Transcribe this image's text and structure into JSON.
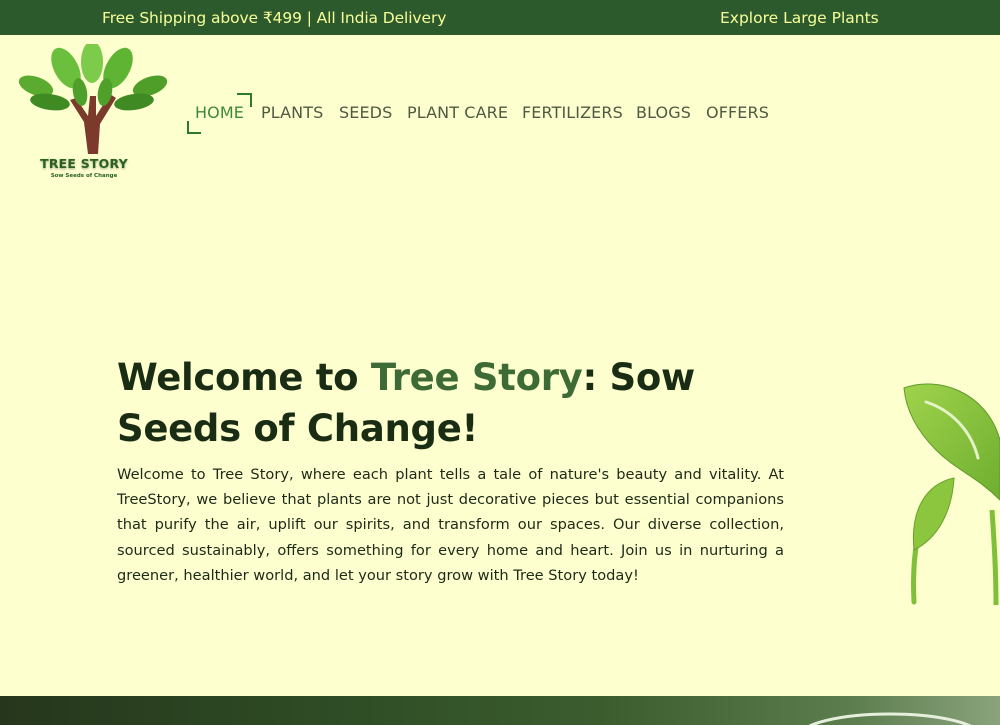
{
  "topbar": {
    "shipping_text": "Free Shipping above ₹499 | All India Delivery",
    "explore_link": "Explore Large Plants"
  },
  "logo": {
    "title": "TREE STORY",
    "tagline": "Sow Seeds of Change"
  },
  "nav": {
    "items": [
      {
        "label": "HOME",
        "active": true
      },
      {
        "label": "PLANTS",
        "active": false
      },
      {
        "label": "SEEDS",
        "active": false
      },
      {
        "label": "PLANT CARE",
        "active": false
      },
      {
        "label": "FERTILIZERS",
        "active": false
      },
      {
        "label": "BLOGS",
        "active": false
      },
      {
        "label": "OFFERS",
        "active": false
      }
    ]
  },
  "hero": {
    "title_part1": "Welcome to ",
    "title_accent": "Tree Story",
    "title_part2": ": Sow Seeds of Change!",
    "paragraph": "Welcome to Tree Story, where each plant tells a tale of nature's beauty and vitality. At TreeStory, we believe that plants are not just decorative pieces but essential companions that purify the air, uplift our spirits, and transform our spaces. Our diverse collection, sourced sustainably, offers something for every home and heart. Join us in nurturing a greener, healthier world, and let your story grow with Tree Story today!"
  },
  "colors": {
    "background": "#fdffcf",
    "topbar": "#2d5a2c",
    "topbar_text": "#f7ff9a",
    "accent_green": "#3e6b35",
    "nav_active": "#3f8a3a",
    "nav_text": "#4f5a42"
  }
}
